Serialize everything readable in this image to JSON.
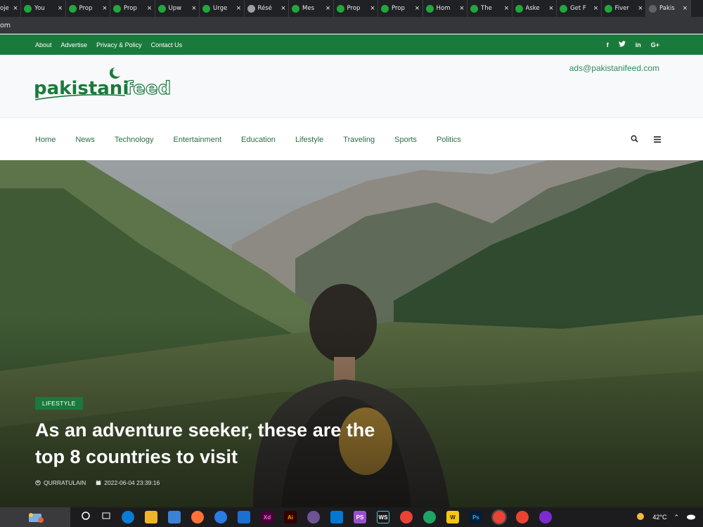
{
  "browser": {
    "tabs": [
      {
        "title": "oje",
        "icon": "page-icon"
      },
      {
        "title": "You",
        "icon": "upwork-icon"
      },
      {
        "title": "Prop",
        "icon": "upwork-icon"
      },
      {
        "title": "Prop",
        "icon": "upwork-icon"
      },
      {
        "title": "Upw",
        "icon": "upwork-icon"
      },
      {
        "title": "Urge",
        "icon": "upwork-icon"
      },
      {
        "title": "Résé",
        "icon": "globe-icon"
      },
      {
        "title": "Mes",
        "icon": "upwork-icon"
      },
      {
        "title": "Prop",
        "icon": "upwork-icon"
      },
      {
        "title": "Prop",
        "icon": "upwork-icon"
      },
      {
        "title": "Hom",
        "icon": "upwork-icon"
      },
      {
        "title": "The",
        "icon": "upwork-icon"
      },
      {
        "title": "Aske",
        "icon": "upwork-icon"
      },
      {
        "title": "Get F",
        "icon": "upwork-icon"
      },
      {
        "title": "Fiver",
        "icon": "fiverr-icon"
      },
      {
        "title": "Pakis",
        "icon": "page-icon"
      }
    ],
    "address_fragment": "om"
  },
  "topbar": {
    "links": [
      "About",
      "Advertise",
      "Privacy & Policy",
      "Contact Us"
    ],
    "social": [
      "f",
      "t",
      "in",
      "G+"
    ]
  },
  "header": {
    "logo_text": "pakistanifeed",
    "email": "ads@pakistanifeed.com"
  },
  "nav": {
    "links": [
      "Home",
      "News",
      "Technology",
      "Entertainment",
      "Education",
      "Lifestyle",
      "Traveling",
      "Sports",
      "Politics"
    ]
  },
  "hero": {
    "category": "LIFESTYLE",
    "title": "As an adventure seeker, these are the top 8 countries to visit",
    "author": "QURRATULAIN",
    "date": "2022-06-04 23:39:16"
  },
  "taskbar": {
    "temperature": "42°C"
  },
  "colors": {
    "brand_green": "#1a7a3b",
    "nav_text": "#2c6e46",
    "link_green": "#2e8b57"
  }
}
